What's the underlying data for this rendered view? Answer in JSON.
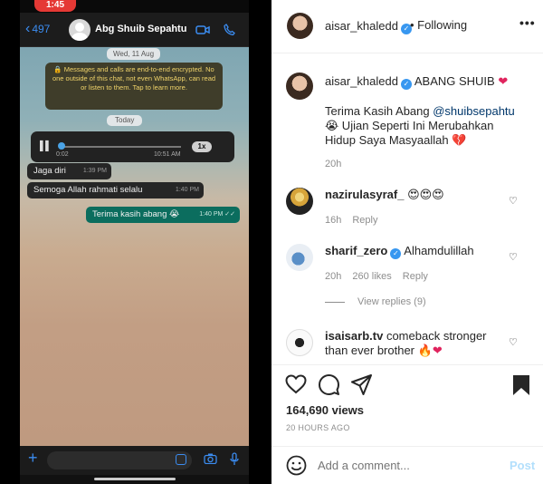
{
  "phone": {
    "status_time": "1:45",
    "back_count": "497",
    "contact_name": "Abg Shuib Sepahtu",
    "date_chip": "Wed, 11 Aug",
    "encryption_notice": "🔒 Messages and calls are end-to-end encrypted. No one outside of this chat, not even WhatsApp, can read or listen to them. Tap to learn more.",
    "today_chip": "Today",
    "voice": {
      "current": "0:02",
      "time": "10:51 AM",
      "speed": "1x"
    },
    "messages": [
      {
        "text": "Jaga diri",
        "time": "1:39 PM"
      },
      {
        "text": "Semoga Allah rahmati selalu",
        "time": "1:40 PM"
      },
      {
        "text": "Terima kasih abang 😭",
        "time": "1:40 PM ✓✓"
      }
    ]
  },
  "header": {
    "username": "aisar_khaledd",
    "follow_state": "• Following",
    "more": "•••"
  },
  "caption": {
    "username": "aisar_khaledd",
    "title": "ABANG SHUIB",
    "line1_prefix": "Terima Kasih Abang ",
    "mention": "@shuibsepahtu",
    "line2": "😭 Ujian Seperti Ini Merubahkan",
    "line3": "Hidup Saya Masyaallah",
    "time": "20h"
  },
  "comments": [
    {
      "username": "nazirulasyraf_",
      "text": "😍😍😍",
      "time": "16h",
      "likes": "",
      "reply": "Reply"
    },
    {
      "username": "sharif_zero",
      "text": "Alhamdulillah",
      "time": "20h",
      "likes": "260 likes",
      "reply": "Reply",
      "view_replies": "View replies (9)"
    },
    {
      "username": "isaisarb.tv",
      "text": "comeback stronger than ever brother 🔥",
      "time": "",
      "likes": "",
      "reply": ""
    }
  ],
  "stats": {
    "views": "164,690 views",
    "ago": "20 HOURS AGO"
  },
  "add_comment": {
    "placeholder": "Add a comment...",
    "post": "Post"
  },
  "colors": {
    "accent": "#3897f0",
    "whatsapp_green": "#0b6d5e",
    "heart": "#e0245e"
  }
}
